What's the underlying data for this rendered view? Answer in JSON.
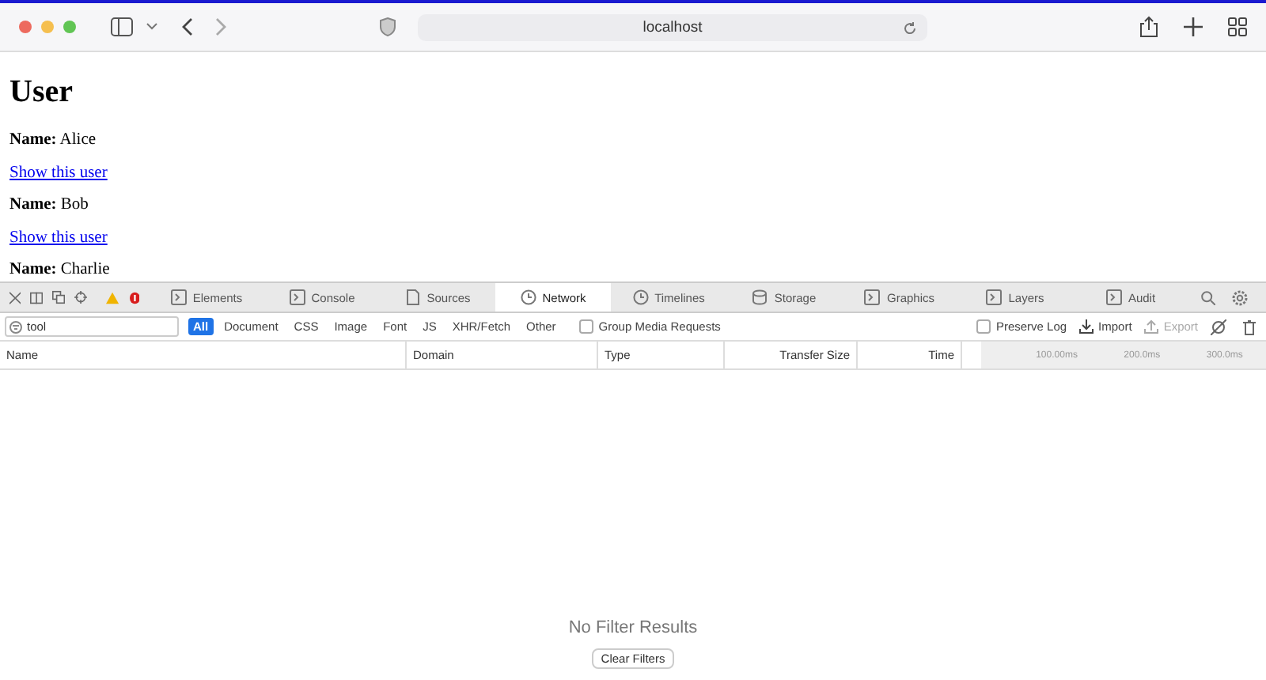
{
  "browser": {
    "url": "localhost"
  },
  "page": {
    "title": "User",
    "items": [
      {
        "kind": "field",
        "label": "Name:",
        "value": "Alice"
      },
      {
        "kind": "link",
        "text": "Show this user"
      },
      {
        "kind": "field",
        "label": "Name:",
        "value": "Bob"
      },
      {
        "kind": "link",
        "text": "Show this user"
      },
      {
        "kind": "field",
        "label": "Name:",
        "value": "Charlie"
      }
    ]
  },
  "devtools": {
    "tabs": [
      {
        "label": "Elements",
        "kind": "panel",
        "selected": false
      },
      {
        "label": "Console",
        "kind": "panel",
        "selected": false
      },
      {
        "label": "Sources",
        "kind": "document",
        "selected": false
      },
      {
        "label": "Network",
        "kind": "clock",
        "selected": true
      },
      {
        "label": "Timelines",
        "kind": "clock",
        "selected": false
      },
      {
        "label": "Storage",
        "kind": "database",
        "selected": false
      },
      {
        "label": "Graphics",
        "kind": "panel",
        "selected": false
      },
      {
        "label": "Layers",
        "kind": "panel",
        "selected": false
      },
      {
        "label": "Audit",
        "kind": "panel",
        "selected": false
      }
    ],
    "filter": {
      "value": "tool"
    },
    "type_filters": [
      {
        "label": "All",
        "selected": true
      },
      {
        "label": "Document",
        "selected": false
      },
      {
        "label": "CSS",
        "selected": false
      },
      {
        "label": "Image",
        "selected": false
      },
      {
        "label": "Font",
        "selected": false
      },
      {
        "label": "JS",
        "selected": false
      },
      {
        "label": "XHR/Fetch",
        "selected": false
      },
      {
        "label": "Other",
        "selected": false
      }
    ],
    "group_media": {
      "label": "Group Media Requests",
      "checked": false
    },
    "preserve_log": {
      "label": "Preserve Log",
      "checked": false
    },
    "import": {
      "label": "Import",
      "disabled": false
    },
    "export": {
      "label": "Export",
      "disabled": true
    },
    "columns": [
      "Name",
      "Domain",
      "Type",
      "Transfer Size",
      "Time"
    ],
    "timeline_ticks": [
      "100.00ms",
      "200.0ms",
      "300.0ms"
    ],
    "empty_message": "No Filter Results",
    "clear_button": "Clear Filters"
  }
}
